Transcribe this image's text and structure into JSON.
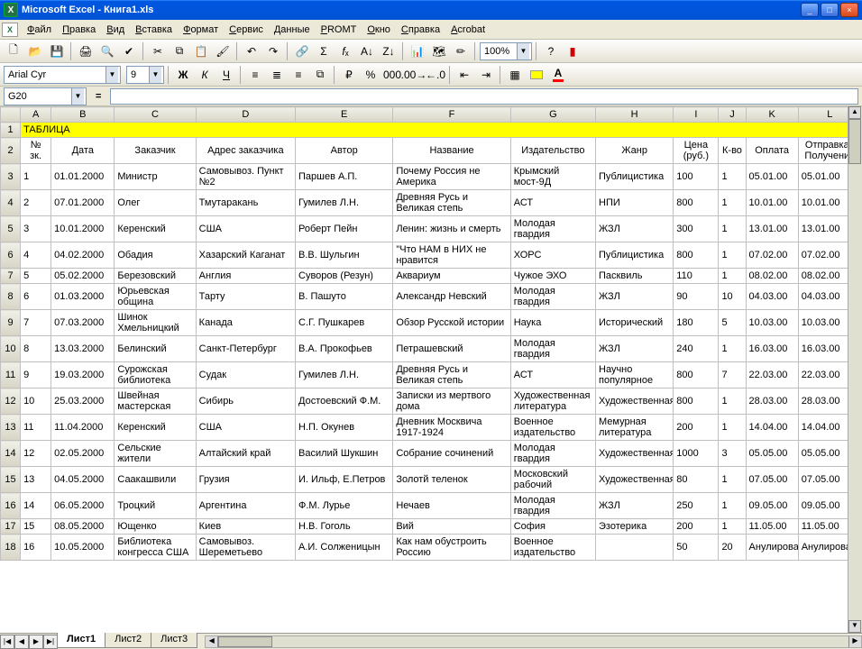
{
  "window": {
    "title": "Microsoft Excel - Книга1.xls"
  },
  "menu": [
    "Файл",
    "Правка",
    "Вид",
    "Вставка",
    "Формат",
    "Сервис",
    "Данные",
    "PROMT",
    "Окно",
    "Справка",
    "Acrobat"
  ],
  "toolbar": {
    "zoom": "100%",
    "font": "Arial Cyr",
    "size": "9"
  },
  "namebox": "G20",
  "formula": "=",
  "columns": [
    "A",
    "B",
    "C",
    "D",
    "E",
    "F",
    "G",
    "H",
    "I",
    "J",
    "K",
    "L"
  ],
  "title_cell": "ТАБЛИЦА",
  "headers": [
    "№ зк.",
    "Дата",
    "Заказчик",
    "Адрес заказчика",
    "Автор",
    "Название",
    "Издательство",
    "Жанр",
    "Цена (руб.)",
    "К-во",
    "Оплата",
    "Отправка / Получение"
  ],
  "rows": [
    {
      "n": "1",
      "date": "01.01.2000",
      "cust": "Министр",
      "addr": "Самовывоз. Пункт №2",
      "author": "Паршев А.П.",
      "title": "Почему Россия не Америка",
      "pub": "Крымский мост-9Д",
      "genre": "Публицистика",
      "price": "100",
      "qty": "1",
      "pay": "05.01.00",
      "ship": "05.01.00"
    },
    {
      "n": "2",
      "date": "07.01.2000",
      "cust": "Олег",
      "addr": "Тмутаракань",
      "author": "Гумилев Л.Н.",
      "title": "Древняя Русь и Великая степь",
      "pub": "АСТ",
      "genre": "НПИ",
      "price": "800",
      "qty": "1",
      "pay": "10.01.00",
      "ship": "10.01.00"
    },
    {
      "n": "3",
      "date": "10.01.2000",
      "cust": "Керенский",
      "addr": "США",
      "author": "Роберт Пейн",
      "title": "Ленин: жизнь и смерть",
      "pub": "Молодая гвардия",
      "genre": "ЖЗЛ",
      "price": "300",
      "qty": "1",
      "pay": "13.01.00",
      "ship": "13.01.00"
    },
    {
      "n": "4",
      "date": "04.02.2000",
      "cust": "Обадия",
      "addr": "Хазарский Каганат",
      "author": "В.В. Шульгин",
      "title": "\"Что НАМ в НИХ не нравится",
      "pub": "ХОРС",
      "genre": "Публицистика",
      "price": "800",
      "qty": "1",
      "pay": "07.02.00",
      "ship": "07.02.00"
    },
    {
      "n": "5",
      "date": "05.02.2000",
      "cust": "Березовский",
      "addr": "Англия",
      "author": "Суворов (Резун)",
      "title": "Аквариум",
      "pub": "Чужое ЭХО",
      "genre": "Пасквиль",
      "price": "110",
      "qty": "1",
      "pay": "08.02.00",
      "ship": "08.02.00"
    },
    {
      "n": "6",
      "date": "01.03.2000",
      "cust": "Юрьевская община",
      "addr": "Тарту",
      "author": "В. Пашуто",
      "title": "Александр Невский",
      "pub": "Молодая гвардия",
      "genre": "ЖЗЛ",
      "price": "90",
      "qty": "10",
      "pay": "04.03.00",
      "ship": "04.03.00"
    },
    {
      "n": "7",
      "date": "07.03.2000",
      "cust": "Шинок Хмельницкий",
      "addr": "Канада",
      "author": "С.Г. Пушкарев",
      "title": "Обзор Русской истории",
      "pub": "Наука",
      "genre": "Исторический",
      "price": "180",
      "qty": "5",
      "pay": "10.03.00",
      "ship": "10.03.00"
    },
    {
      "n": "8",
      "date": "13.03.2000",
      "cust": "Белинский",
      "addr": "Санкт-Петербург",
      "author": "В.А. Прокофьев",
      "title": "Петрашевский",
      "pub": "Молодая гвардия",
      "genre": "ЖЗЛ",
      "price": "240",
      "qty": "1",
      "pay": "16.03.00",
      "ship": "16.03.00"
    },
    {
      "n": "9",
      "date": "19.03.2000",
      "cust": "Сурожская библиотека",
      "addr": "Судак",
      "author": "Гумилев Л.Н.",
      "title": "Древняя Русь и Великая степь",
      "pub": "АСТ",
      "genre": "Научно популярное",
      "price": "800",
      "qty": "7",
      "pay": "22.03.00",
      "ship": "22.03.00"
    },
    {
      "n": "10",
      "date": "25.03.2000",
      "cust": "Швейная мастерская",
      "addr": "Сибирь",
      "author": "Достоевский Ф.М.",
      "title": "Записки из мертвого дома",
      "pub": "Художественная литература",
      "genre": "Художественная",
      "price": "800",
      "qty": "1",
      "pay": "28.03.00",
      "ship": "28.03.00"
    },
    {
      "n": "11",
      "date": "11.04.2000",
      "cust": "Керенский",
      "addr": "США",
      "author": "Н.П. Окунев",
      "title": "Дневник Москвича 1917-1924",
      "pub": "Военное издательство",
      "genre": "Мемурная литература",
      "price": "200",
      "qty": "1",
      "pay": "14.04.00",
      "ship": "14.04.00"
    },
    {
      "n": "12",
      "date": "02.05.2000",
      "cust": "Сельские жители",
      "addr": "Алтайский край",
      "author": "Василий Шукшин",
      "title": "Собрание сочинений",
      "pub": "Молодая гвардия",
      "genre": "Художественная",
      "price": "1000",
      "qty": "3",
      "pay": "05.05.00",
      "ship": "05.05.00"
    },
    {
      "n": "13",
      "date": "04.05.2000",
      "cust": "Саакашвили",
      "addr": "Грузия",
      "author": "И. Ильф, Е.Петров",
      "title": "Золотй теленок",
      "pub": "Московский рабочий",
      "genre": "Художественная",
      "price": "80",
      "qty": "1",
      "pay": "07.05.00",
      "ship": "07.05.00"
    },
    {
      "n": "14",
      "date": "06.05.2000",
      "cust": "Троцкий",
      "addr": "Аргентина",
      "author": "Ф.М. Лурье",
      "title": "Нечаев",
      "pub": "Молодая гвардия",
      "genre": "ЖЗЛ",
      "price": "250",
      "qty": "1",
      "pay": "09.05.00",
      "ship": "09.05.00"
    },
    {
      "n": "15",
      "date": "08.05.2000",
      "cust": "Ющенко",
      "addr": "Киев",
      "author": "Н.В. Гоголь",
      "title": "Вий",
      "pub": "София",
      "genre": "Эзотерика",
      "price": "200",
      "qty": "1",
      "pay": "11.05.00",
      "ship": "11.05.00"
    },
    {
      "n": "16",
      "date": "10.05.2000",
      "cust": "Библиотека конгресса США",
      "addr": "Самовывоз. Шереметьево",
      "author": "А.И. Солженицын",
      "title": "Как нам обустроить Россию",
      "pub": "Военное издательство",
      "genre": "",
      "price": "50",
      "qty": "20",
      "pay": "Анулирован",
      "ship": "Анулирован"
    }
  ],
  "sheets": [
    "Лист1",
    "Лист2",
    "Лист3"
  ],
  "active_sheet": 0
}
